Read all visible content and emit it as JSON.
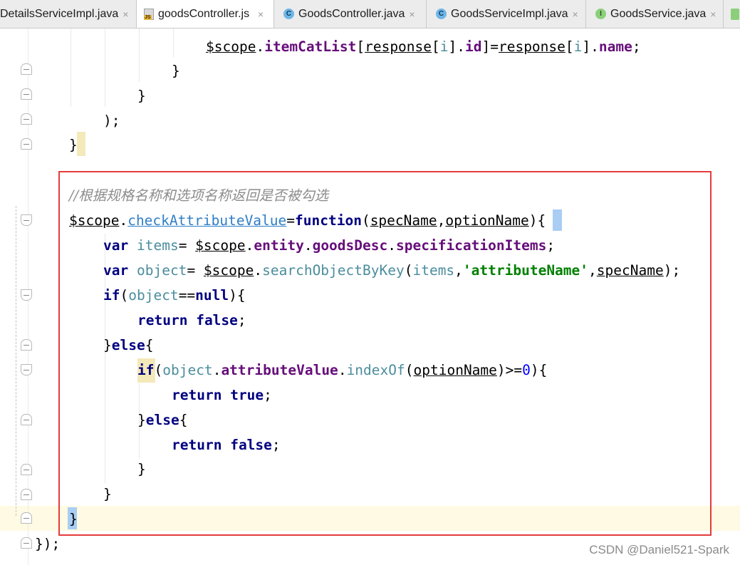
{
  "tabs": [
    {
      "label": "DetailsServiceImpl.java",
      "icon": "none",
      "close": "×"
    },
    {
      "label": "goodsController.js",
      "icon": "js-file-icon",
      "close": "×",
      "active": true
    },
    {
      "label": "GoodsController.java",
      "icon": "class-c-icon",
      "close": "×"
    },
    {
      "label": "GoodsServiceImpl.java",
      "icon": "class-c-icon",
      "close": "×"
    },
    {
      "label": "GoodsService.java",
      "icon": "interface-i-icon",
      "close": "×"
    }
  ],
  "icon_glyphs": {
    "class": "C",
    "interface": "I",
    "js": "JS"
  },
  "code": {
    "l1_scope": "$scope",
    "l1_dot1": ".",
    "l1_list": "itemCatList",
    "l1_br1": "[",
    "l1_resp1": "response",
    "l1_br2": "[",
    "l1_i1": "i",
    "l1_br3": "].",
    "l1_id": "id",
    "l1_eq": "]=",
    "l1_resp2": "response",
    "l1_br4": "[",
    "l1_i2": "i",
    "l1_br5": "].",
    "l1_name": "name",
    "l1_semi": ";",
    "l2": "}",
    "l3": "}",
    "l4": ");",
    "l5": "}",
    "l6_comment": "//根据规格名称和选项名称返回是否被勾选",
    "l7_scope": "$scope",
    "l7_dot": ".",
    "l7_fn": "checkAttributeValue",
    "l7_eq": "=",
    "l7_kw": "function",
    "l7_p1": "(",
    "l7_spec": "specName",
    "l7_comma": ",",
    "l7_opt": "optionName",
    "l7_p2": ")",
    "l7_brace": "{",
    "l8_var": "var",
    "l8_items": "items",
    "l8_eq": "= ",
    "l8_scope": "$scope",
    "l8_dot1": ".",
    "l8_entity": "entity",
    "l8_dot2": ".",
    "l8_gd": "goodsDesc",
    "l8_dot3": ".",
    "l8_si": "specificationItems",
    "l8_semi": ";",
    "l9_var": "var",
    "l9_obj": "object",
    "l9_eq": "= ",
    "l9_scope": "$scope",
    "l9_dot": ".",
    "l9_fn": "searchObjectByKey",
    "l9_p1": "(",
    "l9_items": "items",
    "l9_comma1": ",",
    "l9_str": "'attributeName'",
    "l9_comma2": ",",
    "l9_spec": "specName",
    "l9_p2": ");",
    "l10_if": "if",
    "l10_p1": "(",
    "l10_obj": "object",
    "l10_eq": "==",
    "l10_null": "null",
    "l10_p2": "){",
    "l11_ret": "return",
    "l11_false": "false",
    "l11_semi": ";",
    "l12_brace": "}",
    "l12_else": "else",
    "l12_open": "{",
    "l13_if": "if",
    "l13_p1": "(",
    "l13_obj": "object",
    "l13_dot1": ".",
    "l13_av": "attributeValue",
    "l13_dot2": ".",
    "l13_idx": "indexOf",
    "l13_p2": "(",
    "l13_opt": "optionName",
    "l13_cmp": ")>=",
    "l13_zero": "0",
    "l13_p3": "){",
    "l14_ret": "return",
    "l14_true": "true",
    "l14_semi": ";",
    "l15_brace": "}",
    "l15_else": "else",
    "l15_open": "{",
    "l16_ret": "return",
    "l16_false": "false",
    "l16_semi": ";",
    "l17": "}",
    "l18": "}",
    "l19": "}",
    "l20": "});"
  },
  "watermark": "CSDN @Daniel521-Spark",
  "colors": {
    "highlight_box": "#e53b3b",
    "keyword": "#000080",
    "string": "#008000",
    "property": "#660e7a",
    "comment": "#8c8c8c"
  }
}
